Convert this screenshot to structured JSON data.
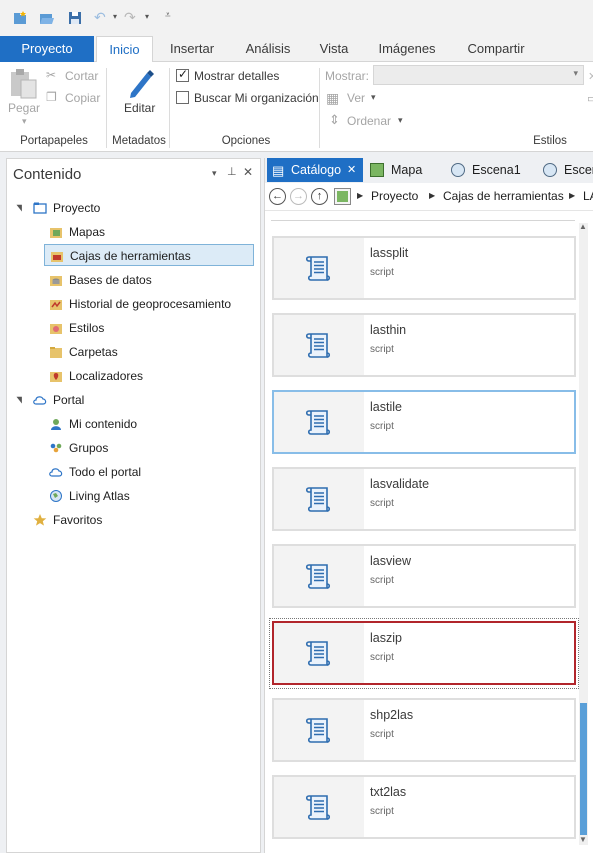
{
  "ribbon": {
    "tabs": [
      "Proyecto",
      "Inicio",
      "Insertar",
      "Análisis",
      "Vista",
      "Imágenes",
      "Compartir"
    ],
    "active_tab": "Inicio",
    "clipboard": {
      "paste": "Pegar",
      "cut": "Cortar",
      "copy": "Copiar",
      "group": "Portapapeles"
    },
    "metadata": {
      "edit": "Editar",
      "group": "Metadatos"
    },
    "options": {
      "show_details": "Mostrar detalles",
      "show_details_checked": true,
      "search_org": "Buscar Mi organización",
      "search_org_checked": false,
      "group": "Opciones"
    },
    "styles": {
      "show_label": "Mostrar:",
      "view": "Ver",
      "sort": "Ordenar",
      "group": "Estilos"
    }
  },
  "contents": {
    "title": "Contenido",
    "tree": [
      {
        "label": "Proyecto",
        "icon": "project-icon",
        "level": 0,
        "expander": "▲"
      },
      {
        "label": "Mapas",
        "icon": "map-folder-icon",
        "level": 1
      },
      {
        "label": "Cajas de herramientas",
        "icon": "toolbox-folder-icon",
        "level": 1,
        "selected": true
      },
      {
        "label": "Bases de datos",
        "icon": "database-icon",
        "level": 1
      },
      {
        "label": "Historial de geoprocesamiento",
        "icon": "history-icon",
        "level": 1
      },
      {
        "label": "Estilos",
        "icon": "styles-icon",
        "level": 1
      },
      {
        "label": "Carpetas",
        "icon": "folder-icon",
        "level": 1
      },
      {
        "label": "Localizadores",
        "icon": "locator-icon",
        "level": 1
      },
      {
        "label": "Portal",
        "icon": "cloud-icon",
        "level": 0,
        "expander": "▲"
      },
      {
        "label": "Mi contenido",
        "icon": "my-content-icon",
        "level": 1
      },
      {
        "label": "Grupos",
        "icon": "groups-icon",
        "level": 1
      },
      {
        "label": "Todo el portal",
        "icon": "cloud-icon",
        "level": 1
      },
      {
        "label": "Living Atlas",
        "icon": "atlas-icon",
        "level": 1
      },
      {
        "label": "Favoritos",
        "icon": "star-icon",
        "level": 0
      }
    ]
  },
  "catalog": {
    "tabs": [
      {
        "label": "Catálogo",
        "active": true
      },
      {
        "label": "Mapa"
      },
      {
        "label": "Escena1"
      },
      {
        "label": "Escen"
      }
    ],
    "breadcrumb": [
      "Proyecto",
      "Cajas de herramientas",
      "LA"
    ],
    "items": [
      {
        "name": "lassplit",
        "type": "script"
      },
      {
        "name": "lasthin",
        "type": "script"
      },
      {
        "name": "lastile",
        "type": "script",
        "state": "focus"
      },
      {
        "name": "lasvalidate",
        "type": "script"
      },
      {
        "name": "lasview",
        "type": "script"
      },
      {
        "name": "laszip",
        "type": "script",
        "state": "selected"
      },
      {
        "name": "shp2las",
        "type": "script"
      },
      {
        "name": "txt2las",
        "type": "script"
      }
    ]
  },
  "colors": {
    "accent": "#1f6fc5",
    "selection_border": "#b1252b",
    "focus_border": "#88bde8",
    "tree_selected": "#dcebf7"
  }
}
